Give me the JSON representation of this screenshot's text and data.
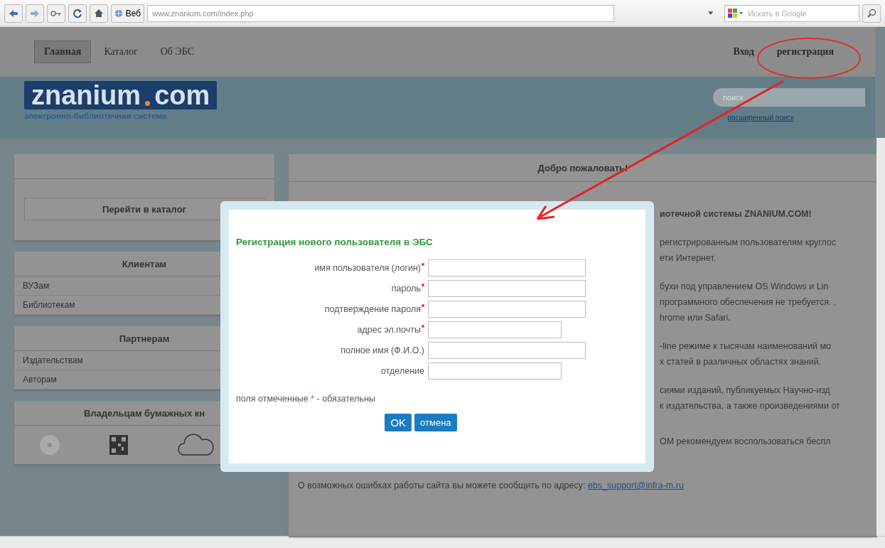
{
  "browser": {
    "web_button": "Веб",
    "url": "www.znanium.com/index.php",
    "search_placeholder": "Искать в Google"
  },
  "nav": {
    "items": [
      {
        "label": "Главная",
        "selected": true
      },
      {
        "label": "Каталог",
        "selected": false
      },
      {
        "label": "Об ЭБС",
        "selected": false
      }
    ],
    "right_items": [
      {
        "label": "Вход"
      },
      {
        "label": "регистрация"
      }
    ]
  },
  "header": {
    "logo_name": "znanium",
    "logo_domain": "com",
    "tagline": "электронно-библиотечная система",
    "search_placeholder": "поиск...",
    "advanced_search": "расширенный поиск"
  },
  "sidebar": [
    {
      "kind": "button",
      "button": "Перейти в каталог"
    },
    {
      "kind": "links",
      "title": "Клиентам",
      "items": [
        "ВУЗам",
        "Библиотекам"
      ]
    },
    {
      "kind": "links",
      "title": "Партнерам",
      "items": [
        "Издательствам",
        "Авторам"
      ]
    },
    {
      "kind": "icons",
      "title": "Владельцам бумажных кн"
    }
  ],
  "main": {
    "title": "Добро пожаловать!",
    "lines": [
      {
        "text": "иотечной системы ZNANIUM.COM!",
        "bold": true
      },
      {
        "text": "регистрированным пользователям круглос",
        "bold": false
      },
      {
        "text": "ети Интернет.",
        "bold": false
      },
      {
        "text": "бухи под управлением OS Windows и Lin",
        "bold": false
      },
      {
        "text": "программного обеспечения не требуется. ,",
        "bold": false
      },
      {
        "text": "hrome или Safari.",
        "bold": false
      },
      {
        "text": "-line режиме к тысячам наименований мо",
        "bold": false
      },
      {
        "text": "х статей в различных областях знаний.",
        "bold": false
      },
      {
        "text": "сиями изданий, публикуемых Научно-изд",
        "bold": false
      },
      {
        "text": "к издательства, а также произведениями от",
        "bold": false
      },
      {
        "text": "ОМ рекомендуем воспользоваться беспл",
        "bold": false
      }
    ],
    "contact": "О возможных ошибках работы сайта вы можете сообщить по адресу:",
    "contact_email": "ebs_support@infra-m.ru"
  },
  "modal": {
    "title": "Регистрация нового пользователя в ЭБС",
    "fields": [
      {
        "label": "имя пользователя (логин)",
        "required": true,
        "wide": true
      },
      {
        "label": "пароль",
        "required": true,
        "wide": true
      },
      {
        "label": "подтверждение пароля",
        "required": true,
        "wide": true
      },
      {
        "label": "адрес эл.почты",
        "required": true,
        "wide": false
      },
      {
        "label": "полное имя (Ф.И.О.)",
        "required": false,
        "wide": true
      },
      {
        "label": "отделение",
        "required": false,
        "wide": false
      }
    ],
    "note_before": "поля отмеченные",
    "note_mark": "*",
    "note_after": "- обязательны",
    "buttons": [
      "OK",
      "отмена"
    ]
  }
}
